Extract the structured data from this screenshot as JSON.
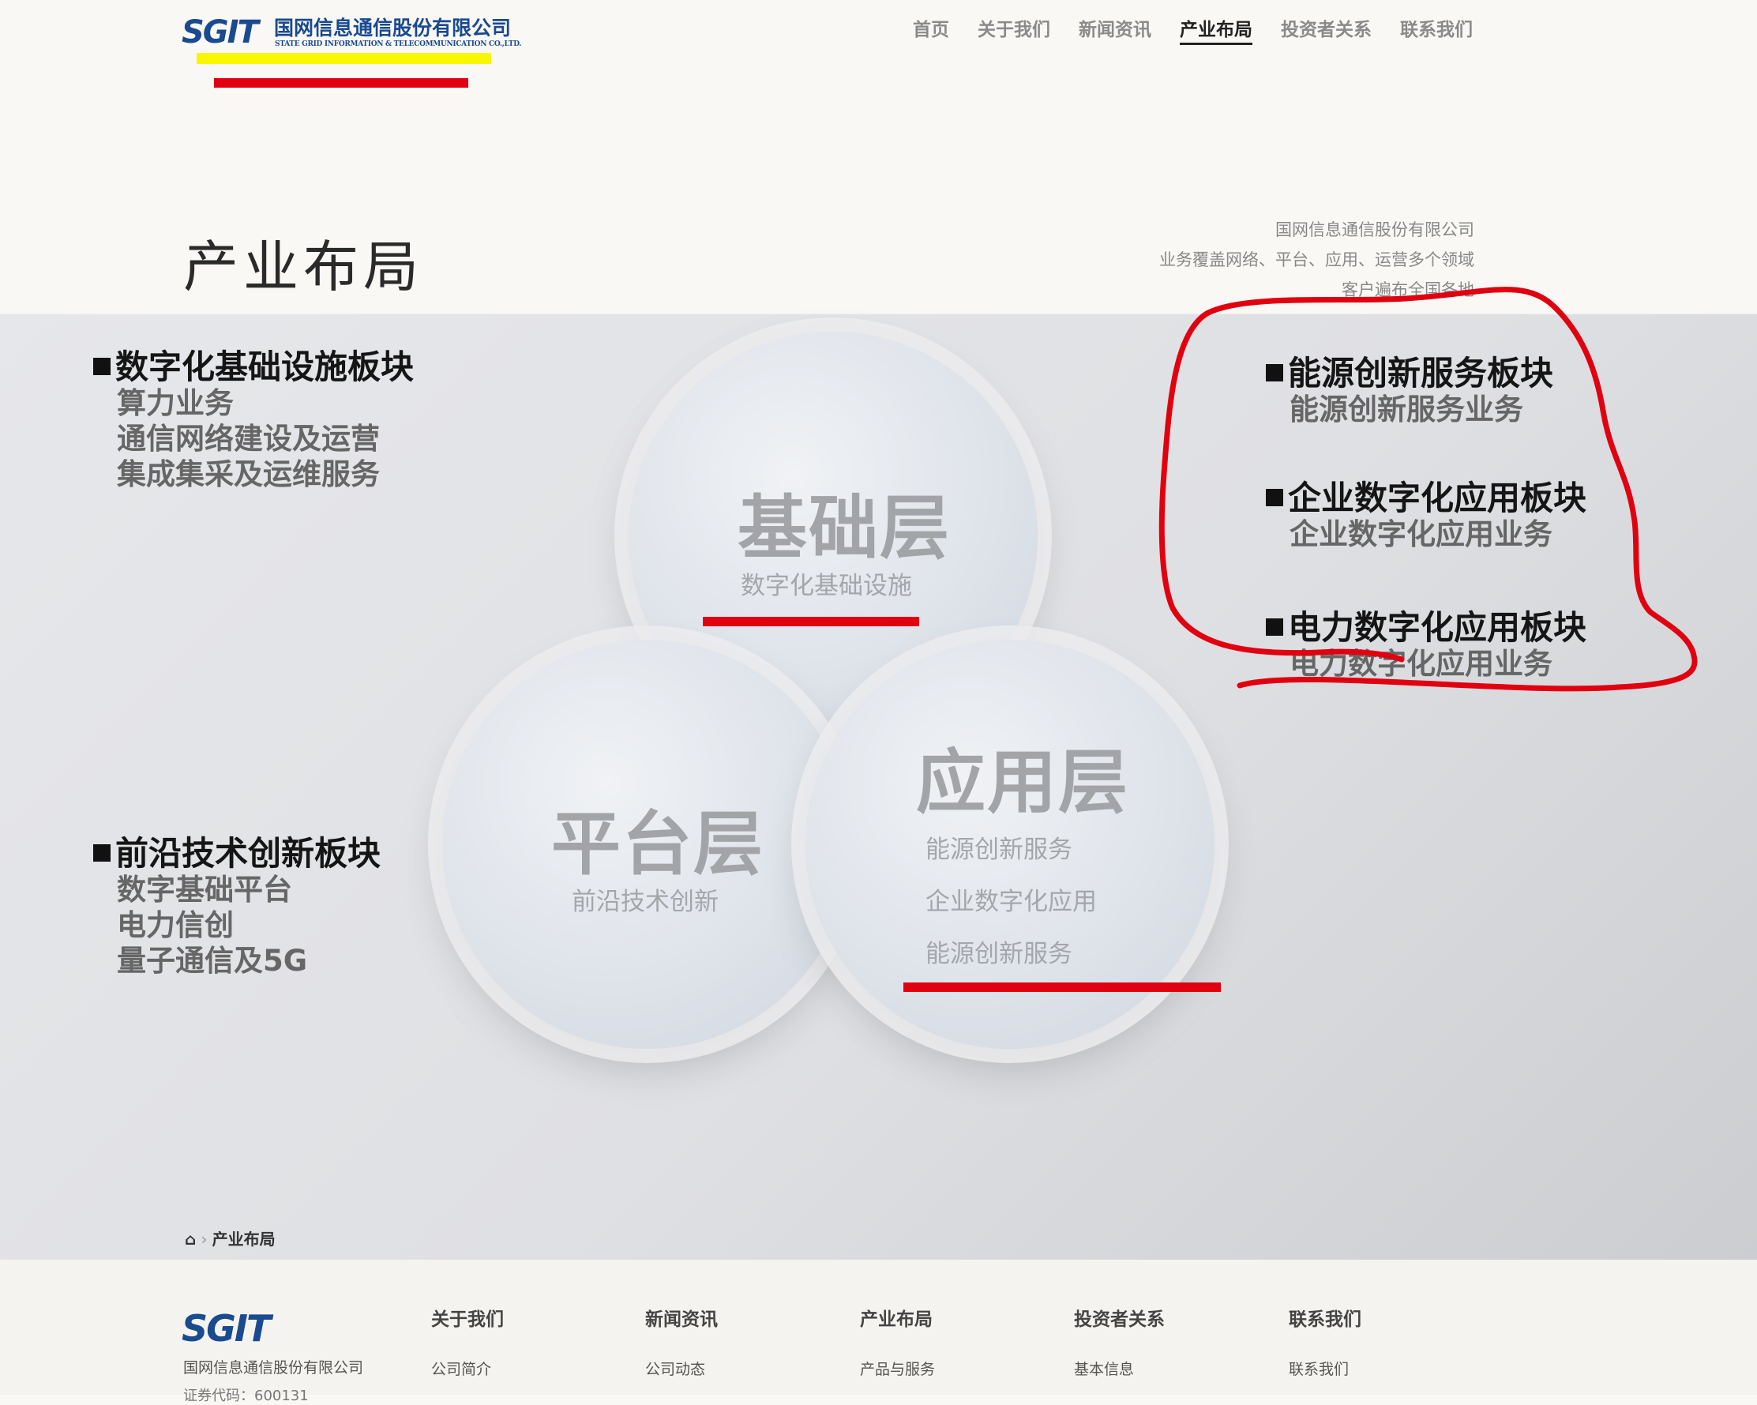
{
  "header": {
    "logo_mark": "SGIT",
    "logo_cn": "国网信息通信股份有限公司",
    "logo_en": "STATE GRID INFORMATION & TELECOMMUNICATION CO.,LTD.",
    "nav": [
      {
        "label": "首页"
      },
      {
        "label": "关于我们"
      },
      {
        "label": "新闻资讯"
      },
      {
        "label": "产业布局",
        "active": true
      },
      {
        "label": "投资者关系"
      },
      {
        "label": "联系我们"
      }
    ]
  },
  "hero": {
    "title": "产业布局",
    "intro": [
      "国网信息通信股份有限公司",
      "业务覆盖网络、平台、应用、运营多个领域",
      "客户遍布全国各地"
    ]
  },
  "layers": {
    "base": {
      "title": "基础层",
      "subs": [
        "数字化基础设施"
      ]
    },
    "platform": {
      "title": "平台层",
      "subs": [
        "前沿技术创新"
      ]
    },
    "application": {
      "title": "应用层",
      "subs": [
        "能源创新服务",
        "企业数字化应用",
        "能源创新服务"
      ]
    }
  },
  "blocks": {
    "digital_infra": {
      "title": "数字化基础设施板块",
      "lines": [
        "算力业务",
        "通信网络建设及运营",
        "集成集采及运维服务"
      ]
    },
    "frontier_tech": {
      "title": "前沿技术创新板块",
      "lines": [
        "数字基础平台",
        "电力信创",
        "量子通信及5G"
      ]
    },
    "energy_service": {
      "title": "能源创新服务板块",
      "lines": [
        "能源创新服务业务"
      ]
    },
    "enterprise_app": {
      "title": "企业数字化应用板块",
      "lines": [
        "企业数字化应用业务"
      ]
    },
    "power_app": {
      "title": "电力数字化应用板块",
      "lines": [
        "电力数字化应用业务"
      ]
    }
  },
  "breadcrumb": {
    "home_icon": "home-icon",
    "current": "产业布局"
  },
  "footer": {
    "logo_mark": "SGIT",
    "company": "国网信息通信股份有限公司",
    "extra": "证券代码：600131",
    "columns": [
      {
        "title": "关于我们",
        "link": "公司简介"
      },
      {
        "title": "新闻资讯",
        "link": "公司动态"
      },
      {
        "title": "产业布局",
        "link": "产品与服务"
      },
      {
        "title": "投资者关系",
        "link": "基本信息"
      },
      {
        "title": "联系我们",
        "link": "联系我们"
      }
    ]
  },
  "colors": {
    "brand_blue": "#1a4a8f",
    "brand_red": "#d8142a",
    "annotation_red": "#e00010",
    "annotation_yellow": "#f8f600"
  }
}
